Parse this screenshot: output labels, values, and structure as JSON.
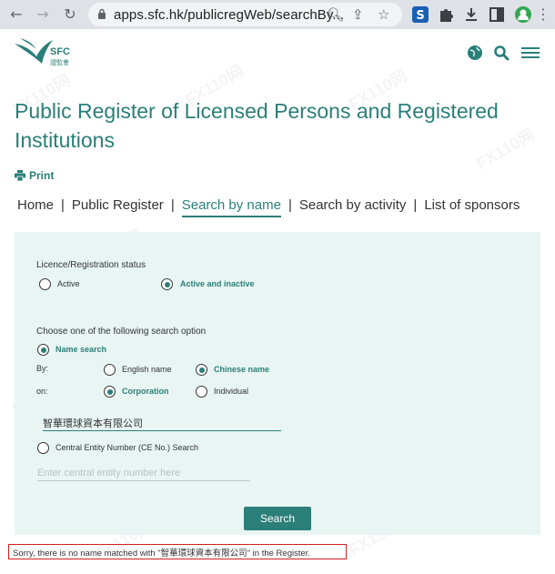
{
  "browser": {
    "url": "apps.sfc.hk/publicregWeb/searchBy..."
  },
  "site": {
    "logo_text": "SFC",
    "logo_sub": "證監會"
  },
  "page": {
    "title": "Public Register of Licensed Persons and Registered Institutions",
    "print_label": "Print"
  },
  "tabs": [
    {
      "label": "Home"
    },
    {
      "label": "Public Register"
    },
    {
      "label": "Search by name"
    },
    {
      "label": "Search by activity"
    },
    {
      "label": "List of sponsors"
    }
  ],
  "form": {
    "status_label": "Licence/Registration status",
    "status_options": [
      {
        "label": "Active",
        "selected": false
      },
      {
        "label": "Active and inactive",
        "selected": true
      }
    ],
    "choose_label": "Choose one of the following search option",
    "name_search_label": "Name search",
    "by_label": "By:",
    "by_options": [
      {
        "label": "English name",
        "selected": false
      },
      {
        "label": "Chinese name",
        "selected": true
      }
    ],
    "on_label": "on:",
    "on_options": [
      {
        "label": "Corporation",
        "selected": true
      },
      {
        "label": "Individual",
        "selected": false
      }
    ],
    "name_value": "智華環球資本有限公司",
    "ce_search_label": "Central Entity Number (CE No.) Search",
    "ce_placeholder": "Enter central entity number here",
    "search_button": "Search"
  },
  "result": {
    "message": "Sorry, there is no name matched with \"智華環球資本有限公司\" in the Register."
  },
  "colors": {
    "brand": "#2a7f78",
    "panel": "#e8f5f3",
    "error_border": "#d12020"
  },
  "watermark": "FX110网"
}
